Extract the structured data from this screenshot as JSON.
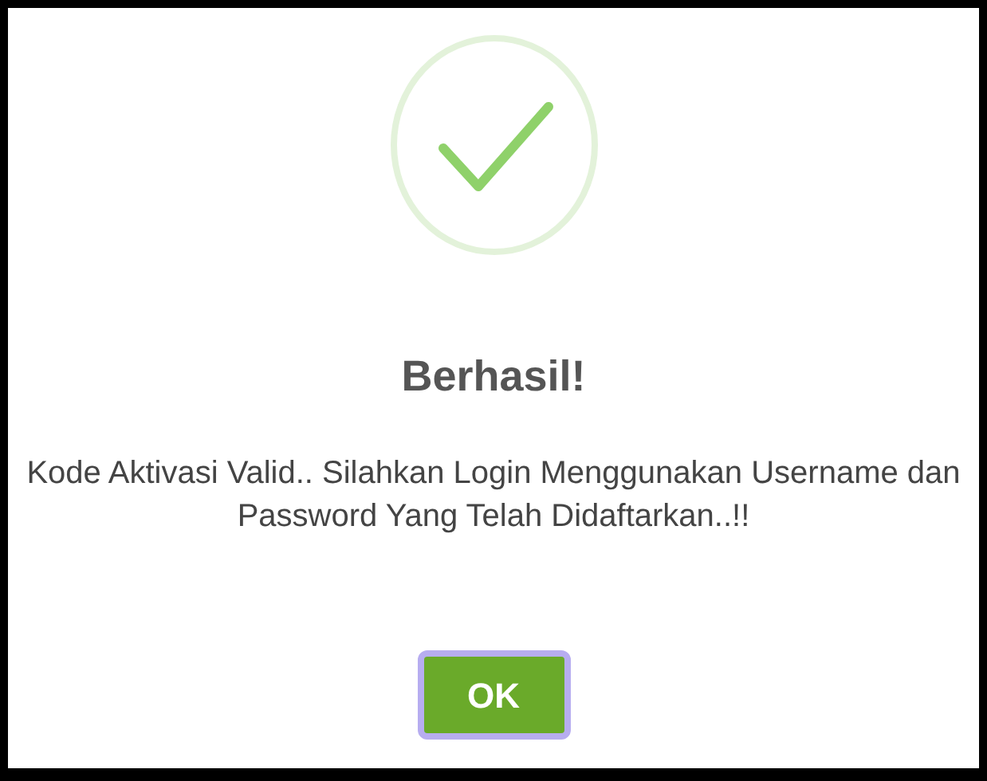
{
  "dialog": {
    "title": "Berhasil!",
    "message": "Kode Aktivasi Valid.. Silahkan Login Menggunakan Username dan Password Yang Telah Didaftarkan..!!",
    "button": {
      "label": "OK",
      "focused": true
    }
  }
}
